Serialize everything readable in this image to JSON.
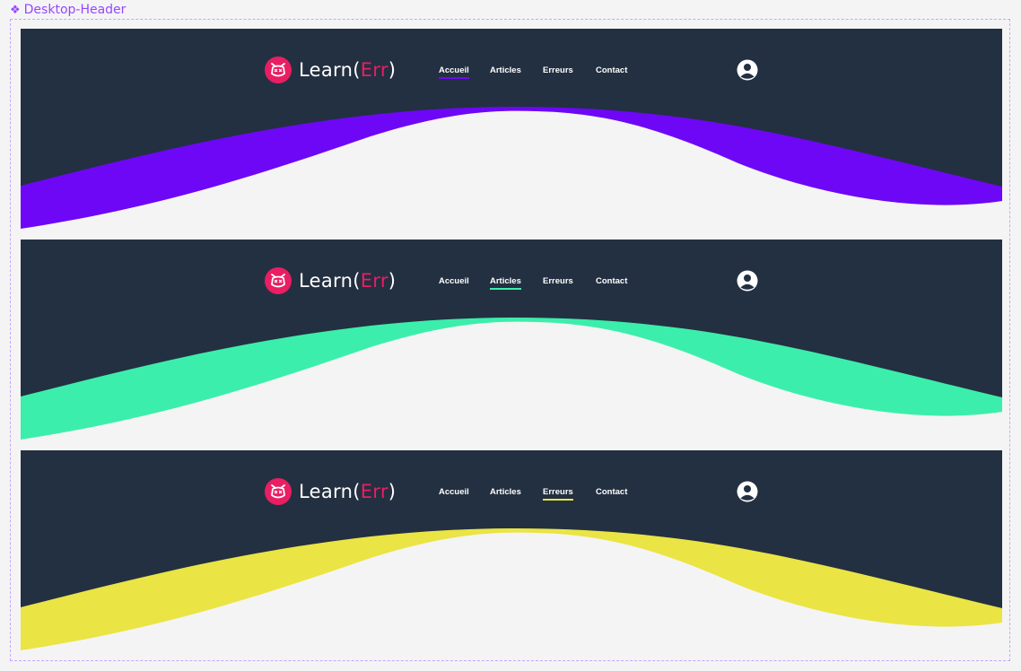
{
  "frame": {
    "label": "Desktop-Header",
    "icon": "component-diamond-icon",
    "accent": "#9747ff"
  },
  "theme": {
    "navbar_bg": "#233041",
    "logo_bg": "#e91e63",
    "page_bg": "#f4f4f5"
  },
  "brand": {
    "name_prefix": "Learn",
    "open_paren": "(",
    "name_accent": "Err",
    "close_paren": ")",
    "icon": "robot-logo-icon"
  },
  "nav_items": [
    "Accueil",
    "Articles",
    "Erreurs",
    "Contact"
  ],
  "variants": [
    {
      "active_index": 0,
      "wave_color": "#6e07f6"
    },
    {
      "active_index": 1,
      "wave_color": "#3ceeab"
    },
    {
      "active_index": 2,
      "wave_color": "#eae444"
    }
  ],
  "user_icon": "user-avatar-icon"
}
